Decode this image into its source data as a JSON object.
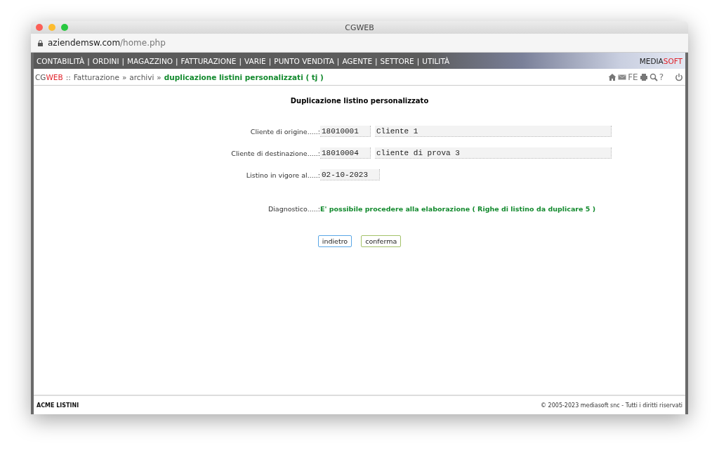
{
  "window": {
    "title": "CGWEB",
    "url_host": "aziendemsw.com",
    "url_path": "/home.php"
  },
  "menu": {
    "separator": "|",
    "items": [
      "CONTABILITÀ",
      "ORDINI",
      "MAGAZZINO",
      "FATTURAZIONE",
      "VARIE",
      "PUNTO VENDITA",
      "AGENTE",
      "SETTORE",
      "UTILITÀ"
    ]
  },
  "brand": {
    "first": "MEDIA",
    "second": "SOFT"
  },
  "breadcrumb": {
    "app_first": "CG",
    "app_second": "WEB",
    "app_separator": "::",
    "arrow": "»",
    "items": [
      "Fatturazione",
      "archivi"
    ],
    "current": "duplicazione listini personalizzati ( tj )"
  },
  "toolbar": [
    {
      "kind": "home"
    },
    {
      "kind": "mail"
    },
    {
      "kind": "text",
      "label": "FE"
    },
    {
      "kind": "print"
    },
    {
      "kind": "search"
    },
    {
      "kind": "text",
      "label": "?"
    },
    {
      "kind": "power"
    }
  ],
  "form": {
    "title": "Duplicazione listino personalizzato",
    "rows": [
      {
        "label": "Cliente di origine.....:",
        "fields": [
          {
            "kind": "code",
            "value": "18010001"
          },
          {
            "kind": "name",
            "value": "Cliente 1"
          }
        ]
      },
      {
        "label": "Cliente di destinazione.....:",
        "fields": [
          {
            "kind": "code",
            "value": "18010004"
          },
          {
            "kind": "name",
            "value": "cliente di prova 3"
          }
        ]
      },
      {
        "label": "Listino in vigore al.....:",
        "fields": [
          {
            "kind": "date",
            "value": "02-10-2023"
          }
        ]
      }
    ],
    "diagnostic": {
      "label": "Diagnostico.....:",
      "message": "E' possibile procedere alla elaborazione ( Righe di listino da duplicare 5 )"
    },
    "buttons": [
      {
        "kind": "back",
        "label": "indietro"
      },
      {
        "kind": "confirm",
        "label": "conferma"
      }
    ]
  },
  "footer": {
    "left": "ACME LISTINI",
    "right": "© 2005-2023 mediasoft snc - Tutti i diritti riservati"
  }
}
